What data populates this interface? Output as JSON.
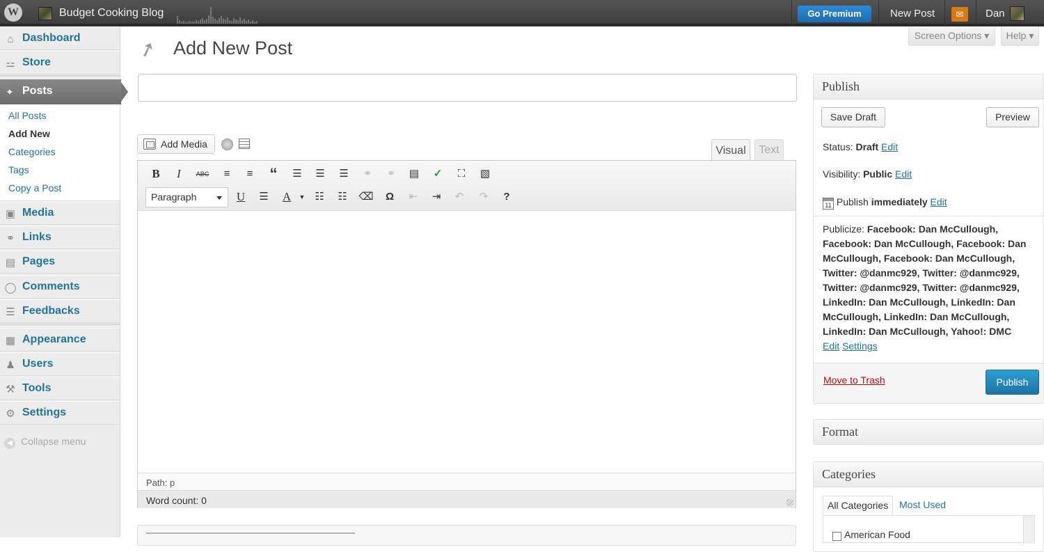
{
  "admin_bar": {
    "site_name": "Budget Cooking Blog",
    "go_premium": "Go Premium",
    "new_post": "New Post",
    "user_name": "Dan",
    "colors": {
      "bar": "#464646",
      "premium": "#1e7ac7",
      "notification": "#d97a0f"
    }
  },
  "sidebar": {
    "items": [
      {
        "label": "Dashboard",
        "icon": "home-icon"
      },
      {
        "label": "Store",
        "icon": "cart-icon"
      },
      {
        "label": "Posts",
        "icon": "pin-icon",
        "active": true
      },
      {
        "label": "Media",
        "icon": "media-icon"
      },
      {
        "label": "Links",
        "icon": "link-icon"
      },
      {
        "label": "Pages",
        "icon": "pages-icon"
      },
      {
        "label": "Comments",
        "icon": "comment-icon"
      },
      {
        "label": "Feedbacks",
        "icon": "feedback-icon"
      },
      {
        "label": "Appearance",
        "icon": "appearance-icon"
      },
      {
        "label": "Users",
        "icon": "users-icon"
      },
      {
        "label": "Tools",
        "icon": "tools-icon"
      },
      {
        "label": "Settings",
        "icon": "settings-icon"
      }
    ],
    "submenu": [
      "All Posts",
      "Add New",
      "Categories",
      "Tags",
      "Copy a Post"
    ],
    "collapse": "Collapse menu"
  },
  "header": {
    "screen_options": "Screen Options ▾",
    "help": "Help ▾",
    "title": "Add New Post"
  },
  "editor": {
    "title_value": "",
    "add_media": "Add Media",
    "tab_visual": "Visual",
    "tab_text": "Text",
    "format_select": "Paragraph",
    "path": "Path: p",
    "word_count": "Word count: 0"
  },
  "publish": {
    "heading": "Publish",
    "save_draft": "Save Draft",
    "preview": "Preview",
    "status_label": "Status:",
    "status_value": "Draft",
    "visibility_label": "Visibility:",
    "visibility_value": "Public",
    "schedule_label": "Publish",
    "schedule_value": "immediately",
    "edit": "Edit",
    "publicize_label": "Publicize:",
    "publicize_value": "Facebook: Dan McCullough, Facebook: Dan McCullough, Facebook: Dan McCullough, Facebook: Dan McCullough, Twitter: @danmc929, Twitter: @danmc929, Twitter: @danmc929, Twitter: @danmc929, LinkedIn: Dan McCullough, LinkedIn: Dan McCullough, LinkedIn: Dan McCullough, LinkedIn: Dan McCullough, Yahoo!: DMC",
    "settings": "Settings",
    "trash": "Move to Trash",
    "publish_button": "Publish"
  },
  "format_box": {
    "heading": "Format"
  },
  "categories_box": {
    "heading": "Categories",
    "tab_all": "All Categories",
    "tab_most": "Most Used",
    "first_item": "American Food"
  }
}
